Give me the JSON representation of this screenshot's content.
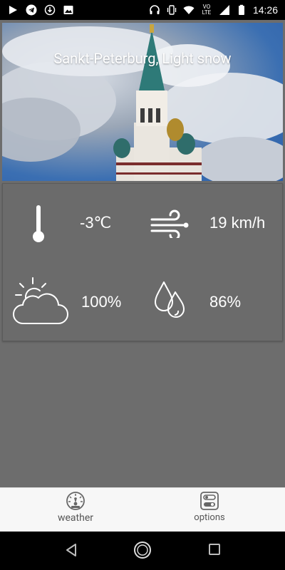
{
  "status_bar": {
    "time": "14:26",
    "network_badge": "VO LTE",
    "icons": [
      "play-icon",
      "telegram-icon",
      "download-icon",
      "image-icon",
      "headphones-icon",
      "vibrate-icon",
      "wifi-icon",
      "signal-icon",
      "battery-icon"
    ]
  },
  "header": {
    "title": "Sankt-Peterburg, Light snow"
  },
  "weather": {
    "temperature": "-3℃",
    "wind": "19 km/h",
    "cloudiness": "100%",
    "humidity": "86%"
  },
  "bottom_nav": {
    "items": [
      {
        "label": "weather",
        "icon": "speedometer-icon"
      },
      {
        "label": "options",
        "icon": "toggle-settings-icon"
      }
    ]
  },
  "system_nav": {
    "buttons": [
      "back-icon",
      "home-icon",
      "recents-icon"
    ]
  },
  "colors": {
    "background": "#6d6d6d",
    "card": "#6b6b6b",
    "bottom_nav_bg": "#f7f7f7",
    "status_bar": "#000000"
  }
}
